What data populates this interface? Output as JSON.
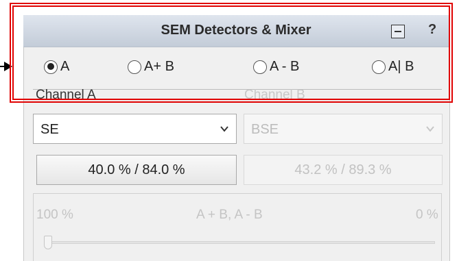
{
  "window": {
    "title": "SEM Detectors & Mixer",
    "minimize_icon": "minimize-icon",
    "help_label": "?"
  },
  "mode_options": [
    {
      "label": "A",
      "selected": true
    },
    {
      "label": "A+ B",
      "selected": false
    },
    {
      "label": "A - B",
      "selected": false
    },
    {
      "label": "A| B",
      "selected": false
    }
  ],
  "channel_a": {
    "label": "Channel A",
    "detector": "SE",
    "readout": "40.0 % / 84.0 %",
    "enabled": true
  },
  "channel_b": {
    "label": "Channel B",
    "detector": "BSE",
    "readout": "43.2 % / 89.3 %",
    "enabled": false
  },
  "mixer": {
    "left_label": "100 %",
    "mid_label": "A + B, A - B",
    "right_label": "0 %",
    "value_fraction": 0.0,
    "enabled": false
  },
  "colors": {
    "highlight": "#e00000",
    "disabled_text": "#c4c4c4"
  }
}
